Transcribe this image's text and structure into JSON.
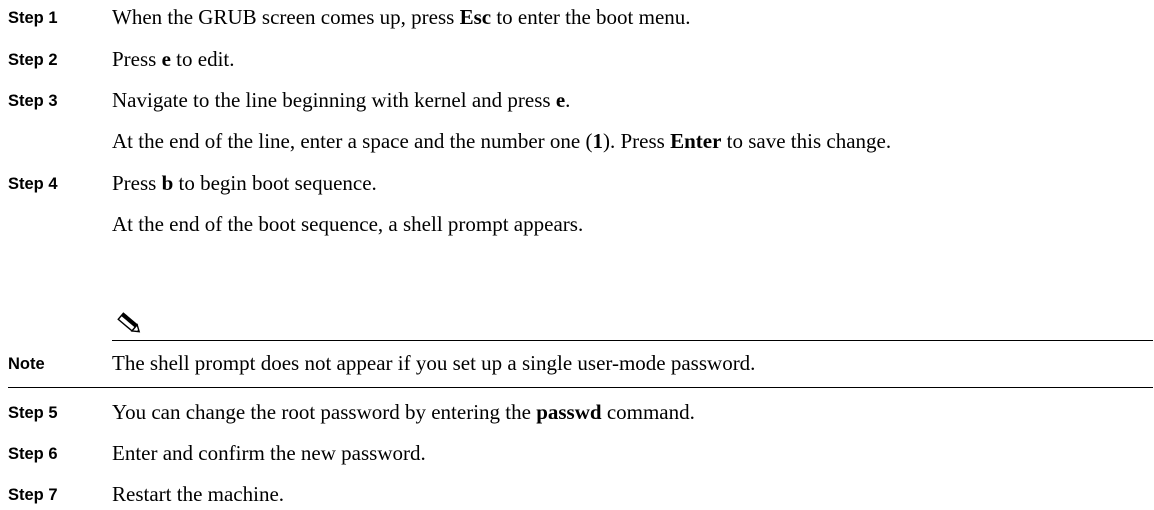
{
  "steps": [
    {
      "label": "Step 1",
      "parts": [
        {
          "t": "When the GRUB screen comes up, press "
        },
        {
          "t": "Esc",
          "b": true
        },
        {
          "t": " to enter the boot menu."
        }
      ]
    },
    {
      "label": "Step 2",
      "parts": [
        {
          "t": "Press "
        },
        {
          "t": "e",
          "b": true
        },
        {
          "t": " to edit."
        }
      ]
    },
    {
      "label": "Step 3",
      "parts": [
        {
          "t": "Navigate to the line beginning with kernel and press "
        },
        {
          "t": "e",
          "b": true
        },
        {
          "t": "."
        }
      ],
      "followup": [
        {
          "t": "At the end of the line, enter a space and the number one ("
        },
        {
          "t": "1",
          "b": true
        },
        {
          "t": "). Press "
        },
        {
          "t": "Enter",
          "b": true
        },
        {
          "t": " to save this change."
        }
      ]
    },
    {
      "label": "Step 4",
      "parts": [
        {
          "t": "Press "
        },
        {
          "t": "b",
          "b": true
        },
        {
          "t": " to begin boot sequence."
        }
      ],
      "followup": [
        {
          "t": "At the end of the boot sequence, a shell prompt appears."
        }
      ]
    },
    {
      "label": "Step 5",
      "parts": [
        {
          "t": "You can change the root password by entering the "
        },
        {
          "t": "passwd",
          "b": true
        },
        {
          "t": " command."
        }
      ]
    },
    {
      "label": "Step 6",
      "parts": [
        {
          "t": "Enter and confirm the new password."
        }
      ]
    },
    {
      "label": "Step 7",
      "parts": [
        {
          "t": "Restart the machine."
        }
      ]
    }
  ],
  "note": {
    "label": "Note",
    "text": "The shell prompt does not appear if you set up a single user-mode password.",
    "icon": "pencil-icon"
  }
}
